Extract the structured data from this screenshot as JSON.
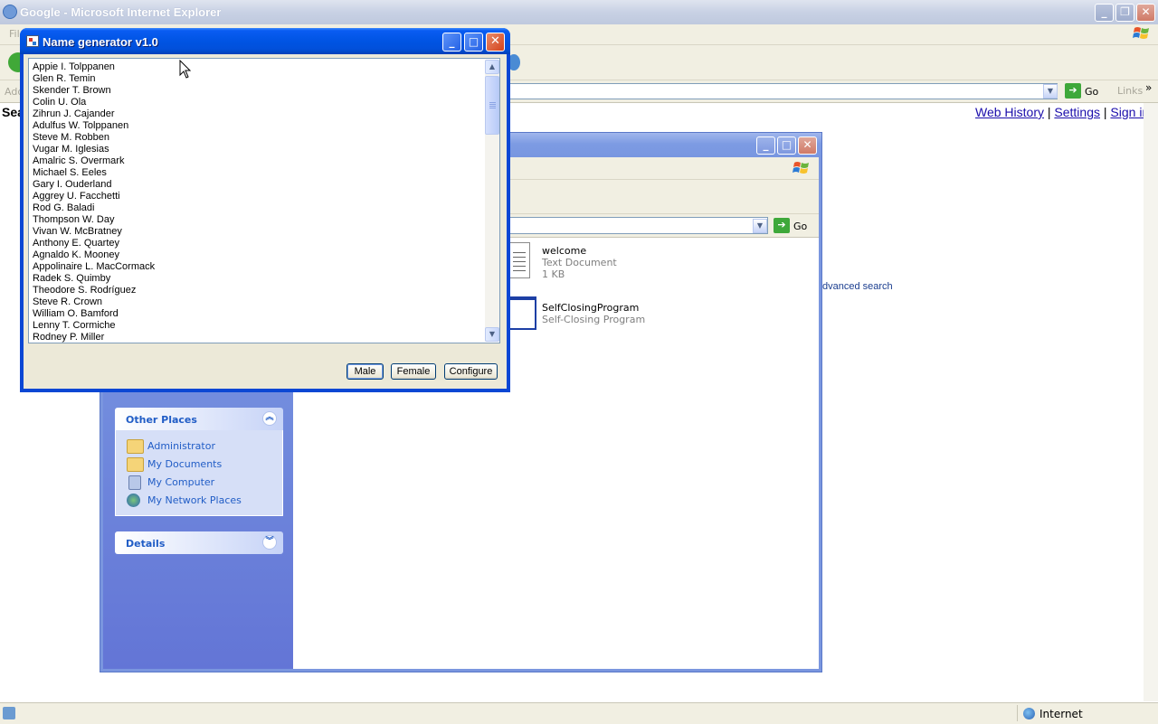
{
  "ie": {
    "title": "Google - Microsoft Internet Explorer",
    "menu_fragment": "Fil",
    "address_label": "Add",
    "go_label": "Go",
    "links_label": "Links",
    "search_fragment": "Sea",
    "header_links": [
      "Web History",
      "Settings",
      "Sign in"
    ],
    "separator": "|",
    "advanced_search": "dvanced search",
    "status_zone": "Internet"
  },
  "explorer": {
    "go_label": "Go",
    "files": [
      {
        "name": "welcome",
        "type": "Text Document",
        "size": "1 KB"
      },
      {
        "name": "SelfClosingProgram",
        "type": "Self-Closing Program"
      }
    ],
    "other_places": {
      "title": "Other Places",
      "items": [
        "Administrator",
        "My Documents",
        "My Computer",
        "My Network Places"
      ]
    },
    "details": {
      "title": "Details"
    }
  },
  "dialog": {
    "title": "Name generator v1.0",
    "names": [
      "Appie I. Tolppanen",
      "Glen R. Temin",
      "Skender T. Brown",
      "Colin U. Ola",
      "Zihrun J. Cajander",
      "Adulfus W. Tolppanen",
      "Steve M. Robben",
      "Vugar M. Iglesias",
      "Amalric S. Overmark",
      "Michael S. Eeles",
      "Gary I. Ouderland",
      "Aggrey U. Facchetti",
      "Rod G. Baladi",
      "Thompson W. Day",
      "Vivan W. McBratney",
      "Anthony E. Quartey",
      "Agnaldo K. Mooney",
      "Appolinaire L. MacCormack",
      "Radek S. Quimby",
      "Theodore S. Rodríguez",
      "Steve R. Crown",
      "William O. Bamford",
      "Lenny T. Cormiche",
      "Rodney P. Miller"
    ],
    "buttons": {
      "male": "Male",
      "female": "Female",
      "configure": "Configure"
    }
  },
  "icons": {
    "minimize": "minimize-icon",
    "maximize": "maximize-icon",
    "close": "close-icon",
    "scroll_up": "scroll-up-arrow-icon",
    "scroll_down": "scroll-down-arrow-icon",
    "collapse": "chevron-up-icon",
    "expand": "chevron-down-icon"
  },
  "colors": {
    "xp_title_blue": "#0054e3",
    "link_blue": "#215dc6",
    "close_red": "#d4431c",
    "taskpane_blue": "#6375d6"
  }
}
